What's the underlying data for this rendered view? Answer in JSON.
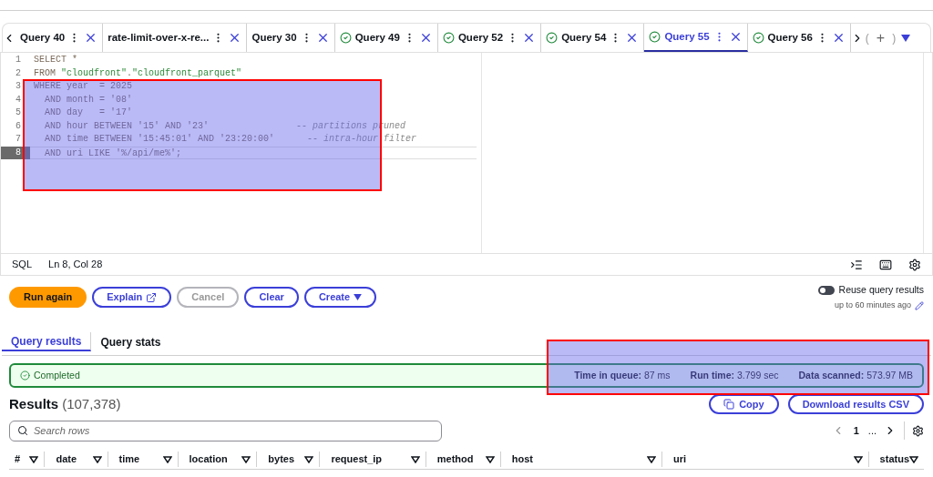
{
  "query_tabs": [
    {
      "label": "Query 40",
      "completed": false,
      "selected": false
    },
    {
      "label": "rate-limit-over-x-re...",
      "completed": false,
      "selected": false
    },
    {
      "label": "Query 30",
      "completed": false,
      "selected": false
    },
    {
      "label": "Query 49",
      "completed": true,
      "selected": false
    },
    {
      "label": "Query 52",
      "completed": true,
      "selected": false
    },
    {
      "label": "Query 54",
      "completed": true,
      "selected": false
    },
    {
      "label": "Query 55",
      "completed": true,
      "selected": true
    },
    {
      "label": "Query 56",
      "completed": true,
      "selected": false
    }
  ],
  "tab_controls": {
    "open_paren": "(",
    "add": "+",
    "close_paren": ")"
  },
  "editor": {
    "lines": [
      {
        "number": "1",
        "current": false,
        "tokens": [
          {
            "kind": "code",
            "text": "SELECT *"
          }
        ]
      },
      {
        "number": "2",
        "current": false,
        "tokens": [
          {
            "kind": "code",
            "text": "FROM "
          },
          {
            "kind": "string",
            "text": "\"cloudfront\""
          },
          {
            "kind": "code",
            "text": "."
          },
          {
            "kind": "string",
            "text": "\"cloudfront_parquet\""
          }
        ]
      },
      {
        "number": "3",
        "current": false,
        "tokens": [
          {
            "kind": "code",
            "text": "WHERE year  = 2025"
          }
        ]
      },
      {
        "number": "4",
        "current": false,
        "tokens": [
          {
            "kind": "code",
            "text": "  AND month = '08'"
          }
        ]
      },
      {
        "number": "5",
        "current": false,
        "tokens": [
          {
            "kind": "code",
            "text": "  AND day   = '17'"
          }
        ]
      },
      {
        "number": "6",
        "current": false,
        "tokens": [
          {
            "kind": "code",
            "text": "  AND hour BETWEEN '15' AND '23'                "
          },
          {
            "kind": "comment",
            "text": "-- partitions pruned"
          }
        ]
      },
      {
        "number": "7",
        "current": false,
        "tokens": [
          {
            "kind": "code",
            "text": "  AND time BETWEEN '15:45:01' AND '23:20:00'      "
          },
          {
            "kind": "comment",
            "text": "-- intra-hour filter"
          }
        ]
      },
      {
        "number": "8",
        "current": true,
        "tokens": [
          {
            "kind": "code",
            "text": "  AND uri LIKE '%/api/me%';"
          }
        ]
      }
    ]
  },
  "status_bar": {
    "language": "SQL",
    "position": "Ln 8, Col 28"
  },
  "actions": [
    {
      "label": "Run again",
      "kind": "primary",
      "disabled": false
    },
    {
      "label": "Explain",
      "kind": "external",
      "disabled": false
    },
    {
      "label": "Cancel",
      "kind": "normal",
      "disabled": true
    },
    {
      "label": "Clear",
      "kind": "normal",
      "disabled": false
    },
    {
      "label": "Create",
      "kind": "dropdown",
      "disabled": false
    }
  ],
  "reuse": {
    "label": "Reuse query results",
    "on": false,
    "hint": "up to 60 minutes ago"
  },
  "result_tabs": [
    {
      "label": "Query results",
      "selected": true
    },
    {
      "label": "Query stats",
      "selected": false
    }
  ],
  "status": {
    "label": "Completed",
    "stats": [
      {
        "name": "Time in queue:",
        "value": "87 ms"
      },
      {
        "name": "Run time:",
        "value": "3.799 sec"
      },
      {
        "name": "Data scanned:",
        "value": "573.97 MB"
      }
    ]
  },
  "results": {
    "title": "Results",
    "count": "(107,378)",
    "copy": "Copy",
    "download": "Download results CSV",
    "search_placeholder": "Search rows",
    "page": "1",
    "ellipsis": "..."
  },
  "table": {
    "columns": [
      "#",
      "date",
      "time",
      "location",
      "bytes",
      "request_ip",
      "method",
      "host",
      "uri",
      "status"
    ]
  }
}
